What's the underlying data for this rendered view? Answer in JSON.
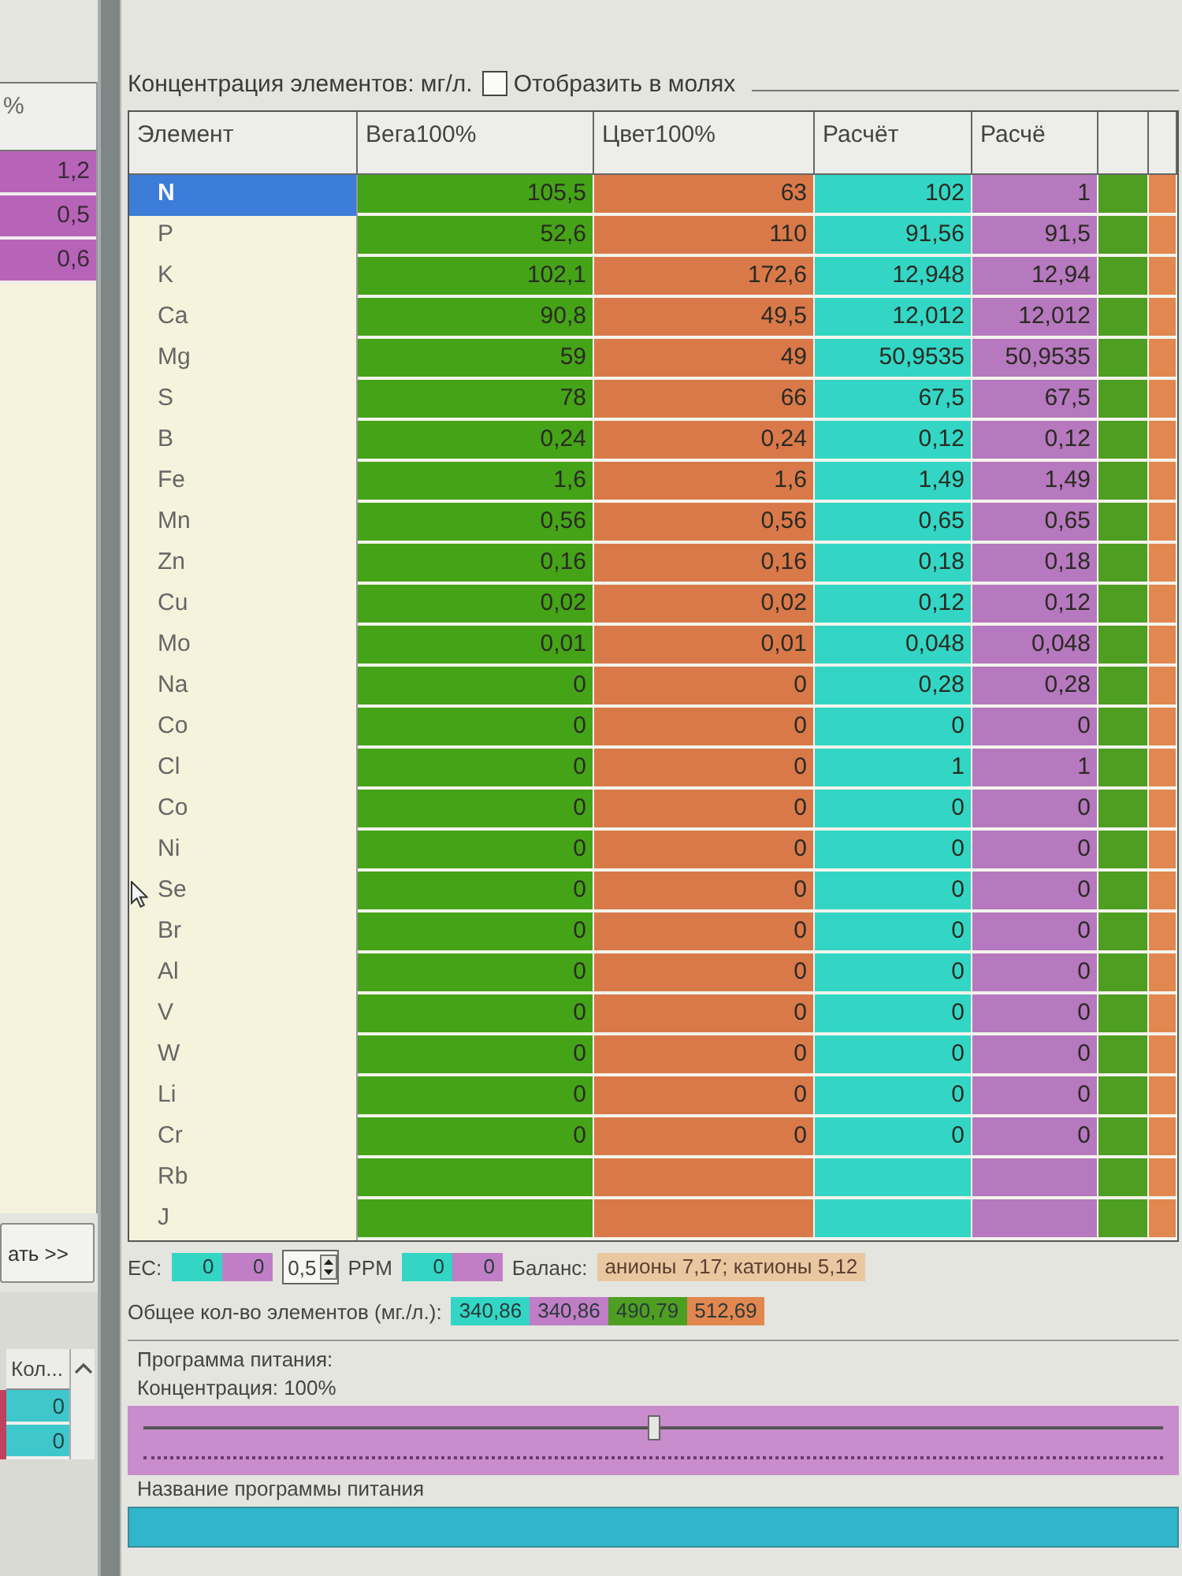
{
  "left_panel": {
    "header": "%",
    "values": [
      "1,2",
      "0,5",
      "0,6"
    ],
    "button": "ать >>",
    "lower_table": {
      "header": "Кол...",
      "values": [
        "0",
        "0"
      ]
    }
  },
  "concentration": {
    "title": "Концентрация элементов: мг/л.",
    "checkbox": {
      "label": "Отобразить в молях",
      "checked": false
    }
  },
  "table": {
    "columns": [
      {
        "header": "Элемент"
      },
      {
        "header": "Вега100%",
        "color": "#45a318"
      },
      {
        "header": "Цвет100%",
        "color": "#d9794a"
      },
      {
        "header": "Расчёт",
        "color": "#33d6c4"
      },
      {
        "header": "Расчё",
        "color": "#b678be"
      },
      {
        "color": "#4e9e22"
      },
      {
        "color": "#e2874f"
      }
    ],
    "rows": [
      {
        "element": "N",
        "selected": true,
        "values": [
          "105,5",
          "63",
          "102",
          "1"
        ]
      },
      {
        "element": "P",
        "selected": false,
        "values": [
          "52,6",
          "110",
          "91,56",
          "91,5"
        ]
      },
      {
        "element": "K",
        "selected": false,
        "values": [
          "102,1",
          "172,6",
          "12,948",
          "12,94"
        ]
      },
      {
        "element": "Ca",
        "selected": false,
        "values": [
          "90,8",
          "49,5",
          "12,012",
          "12,012"
        ]
      },
      {
        "element": "Mg",
        "selected": false,
        "values": [
          "59",
          "49",
          "50,9535",
          "50,9535"
        ]
      },
      {
        "element": "S",
        "selected": false,
        "values": [
          "78",
          "66",
          "67,5",
          "67,5"
        ]
      },
      {
        "element": "B",
        "selected": false,
        "values": [
          "0,24",
          "0,24",
          "0,12",
          "0,12"
        ]
      },
      {
        "element": "Fe",
        "selected": false,
        "values": [
          "1,6",
          "1,6",
          "1,49",
          "1,49"
        ]
      },
      {
        "element": "Mn",
        "selected": false,
        "values": [
          "0,56",
          "0,56",
          "0,65",
          "0,65"
        ]
      },
      {
        "element": "Zn",
        "selected": false,
        "values": [
          "0,16",
          "0,16",
          "0,18",
          "0,18"
        ]
      },
      {
        "element": "Cu",
        "selected": false,
        "values": [
          "0,02",
          "0,02",
          "0,12",
          "0,12"
        ]
      },
      {
        "element": "Mo",
        "selected": false,
        "values": [
          "0,01",
          "0,01",
          "0,048",
          "0,048"
        ]
      },
      {
        "element": "Na",
        "selected": false,
        "values": [
          "0",
          "0",
          "0,28",
          "0,28"
        ]
      },
      {
        "element": "Co",
        "selected": false,
        "values": [
          "0",
          "0",
          "0",
          "0"
        ]
      },
      {
        "element": "Cl",
        "selected": false,
        "values": [
          "0",
          "0",
          "1",
          "1"
        ]
      },
      {
        "element": "Co",
        "selected": false,
        "values": [
          "0",
          "0",
          "0",
          "0"
        ]
      },
      {
        "element": "Ni",
        "selected": false,
        "values": [
          "0",
          "0",
          "0",
          "0"
        ]
      },
      {
        "element": "Se",
        "selected": false,
        "values": [
          "0",
          "0",
          "0",
          "0"
        ]
      },
      {
        "element": "Br",
        "selected": false,
        "values": [
          "0",
          "0",
          "0",
          "0"
        ]
      },
      {
        "element": "Al",
        "selected": false,
        "values": [
          "0",
          "0",
          "0",
          "0"
        ]
      },
      {
        "element": "V",
        "selected": false,
        "values": [
          "0",
          "0",
          "0",
          "0"
        ]
      },
      {
        "element": "W",
        "selected": false,
        "values": [
          "0",
          "0",
          "0",
          "0"
        ]
      },
      {
        "element": "Li",
        "selected": false,
        "values": [
          "0",
          "0",
          "0",
          "0"
        ]
      },
      {
        "element": "Cr",
        "selected": false,
        "values": [
          "0",
          "0",
          "0",
          "0"
        ]
      },
      {
        "element": "Rb",
        "selected": false
      },
      {
        "element": "J",
        "selected": false
      }
    ]
  },
  "summary": {
    "ec": {
      "label": "EC:",
      "boxes": [
        {
          "value": "0",
          "color": "#33d6c4"
        },
        {
          "value": "0",
          "color": "#c07ec6"
        }
      ],
      "spin": "0,5"
    },
    "ppm": {
      "label": "PPM",
      "boxes": [
        {
          "value": "0",
          "color": "#33d6c4"
        },
        {
          "value": "0",
          "color": "#c07ec6"
        }
      ]
    },
    "balance": {
      "label": "Баланс:",
      "value": "анионы 7,17; катионы 5,12"
    },
    "totals": {
      "label": "Общее кол-во элементов (мг./л.):",
      "boxes": [
        {
          "value": "340,86",
          "color": "#33d6c4"
        },
        {
          "value": "340,86",
          "color": "#c07ec6"
        },
        {
          "value": "490,79",
          "color": "#4e9e22"
        },
        {
          "value": "512,69",
          "color": "#e2874f"
        }
      ]
    }
  },
  "program": {
    "title": "Программа питания:",
    "concentration_label": "Концентрация: 100%",
    "slider": {
      "level": 0.5
    },
    "name_label": "Название программы питания"
  }
}
